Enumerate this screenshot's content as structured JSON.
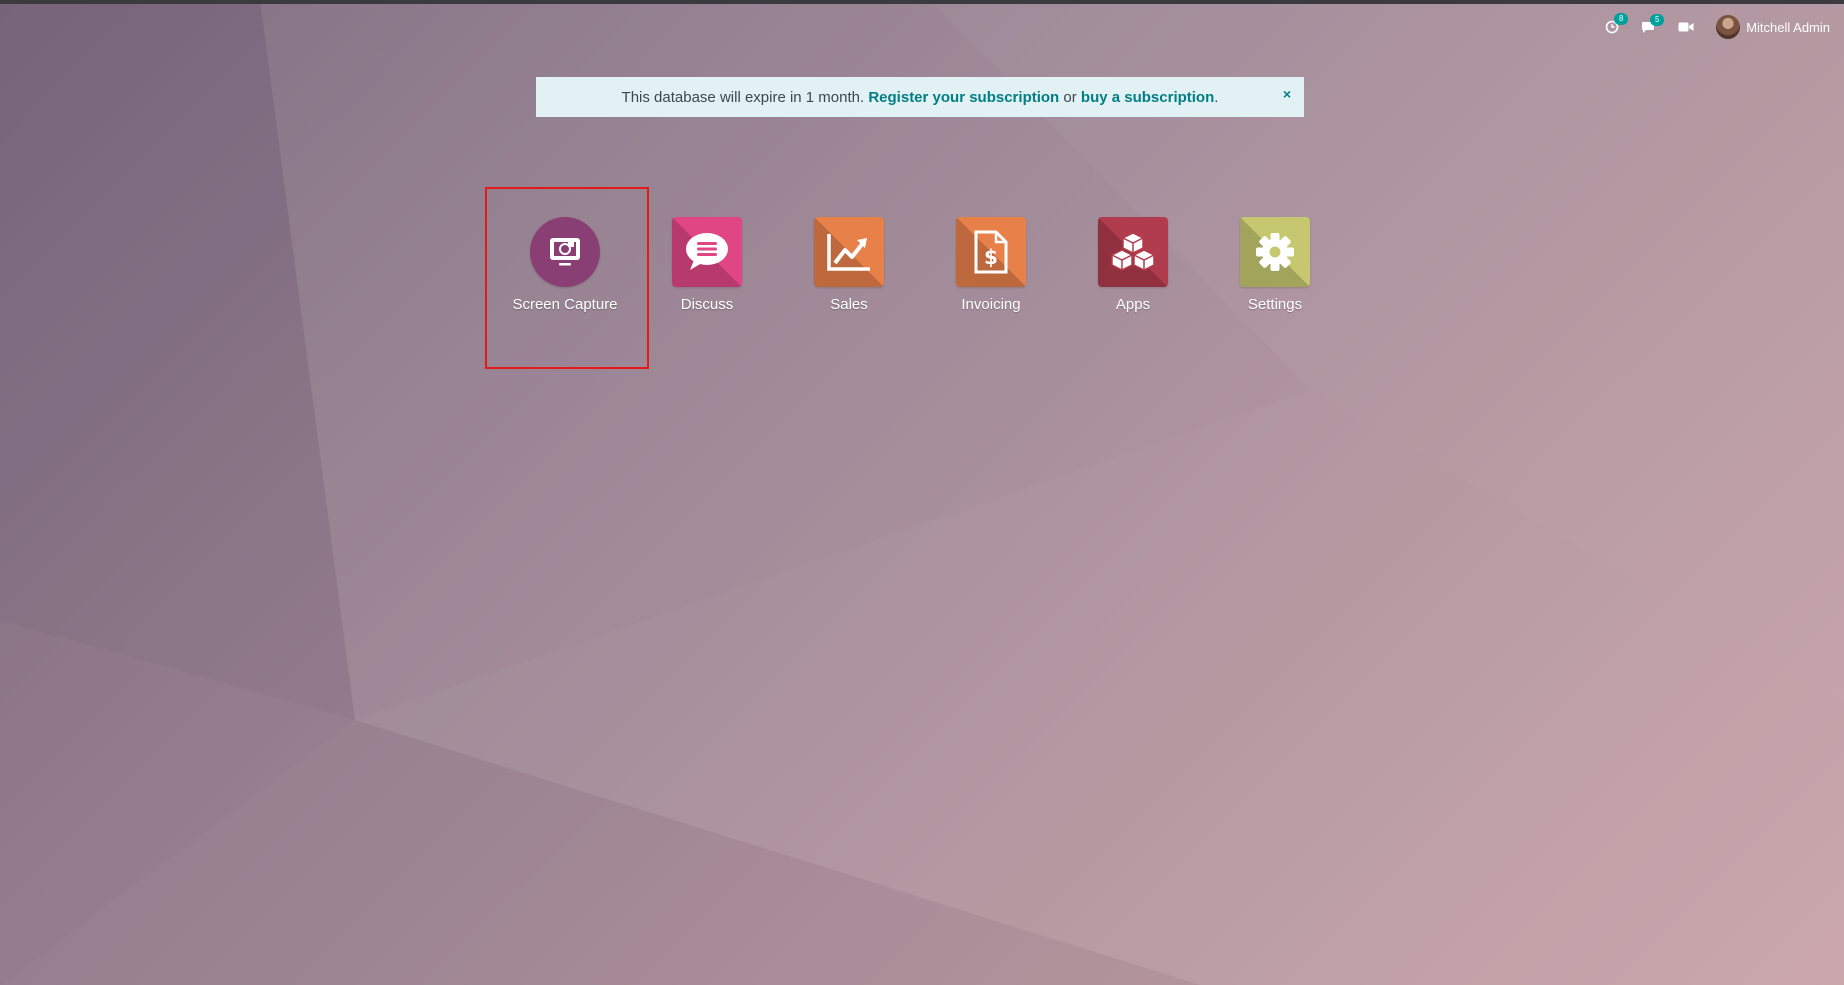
{
  "alert": {
    "text_before": "This database will expire in 1 month. ",
    "register_link": "Register your subscription",
    "text_middle": " or ",
    "buy_link": "buy a subscription",
    "text_after": ".",
    "close_glyph": "×"
  },
  "systray": {
    "activities_badge": "8",
    "messages_badge": "5",
    "user_name": "Mitchell Admin"
  },
  "apps": [
    {
      "label": "Screen Capture",
      "icon": "screen-capture-icon",
      "color": "#8a3f74"
    },
    {
      "label": "Discuss",
      "icon": "chat-bubble-icon",
      "color": "#e04683"
    },
    {
      "label": "Sales",
      "icon": "sales-chart-icon",
      "color": "#e8804a"
    },
    {
      "label": "Invoicing",
      "icon": "invoice-dollar-icon",
      "color": "#e8804a"
    },
    {
      "label": "Apps",
      "icon": "cubes-icon",
      "color": "#b13c4d"
    },
    {
      "label": "Settings",
      "icon": "gear-icon",
      "color": "#c6c86f"
    }
  ],
  "colors": {
    "link": "#017e84",
    "alert_bg": "#e2f1f4",
    "badge": "#00a09d",
    "highlight": "#e11a1a"
  }
}
